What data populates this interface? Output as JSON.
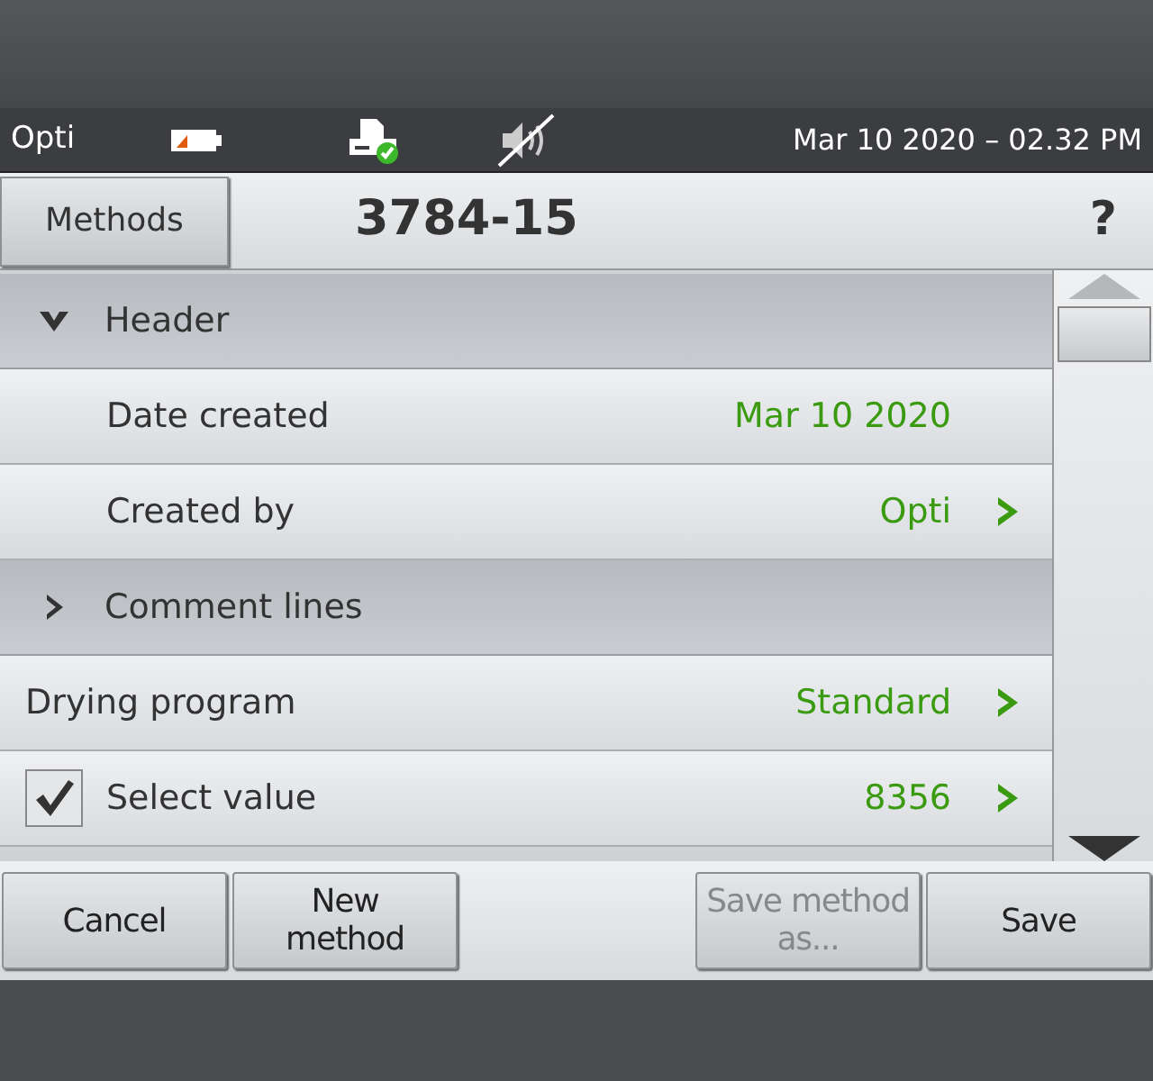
{
  "status_bar": {
    "user": "Opti",
    "datetime": "Mar 10 2020 – 02.32 PM"
  },
  "title_bar": {
    "methods_button": "Methods",
    "title": "3784-15",
    "help": "?"
  },
  "list": [
    {
      "kind": "section",
      "label": "Header",
      "expanded": true,
      "children": [
        {
          "kind": "field",
          "label": "Date created",
          "value": "Mar 10 2020",
          "arrow": false
        },
        {
          "kind": "field",
          "label": "Created by",
          "value": "Opti",
          "arrow": true
        }
      ]
    },
    {
      "kind": "section",
      "label": "Comment lines",
      "expanded": false
    },
    {
      "kind": "field",
      "label": "Drying program",
      "value": "Standard",
      "arrow": true
    },
    {
      "kind": "check",
      "label": "Select value",
      "value": "8356",
      "checked": true,
      "arrow": true
    }
  ],
  "left_buttons": [
    {
      "label": "Cancel",
      "disabled": false
    },
    {
      "label": "New method",
      "disabled": false
    }
  ],
  "right_buttons": [
    {
      "label": "Save method as...",
      "disabled": true
    },
    {
      "label": "Save",
      "disabled": false
    }
  ]
}
